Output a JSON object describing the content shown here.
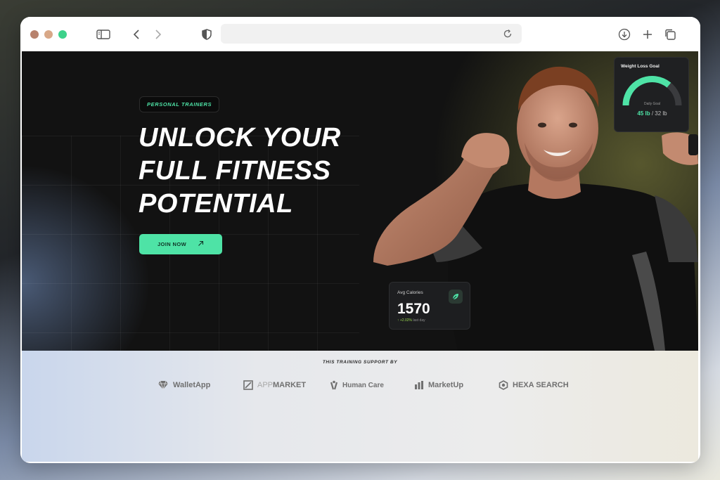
{
  "hero": {
    "badge": "PERSONAL TRAINERS",
    "headline": [
      "UNLOCK YOUR",
      "FULL FITNESS",
      "POTENTIAL"
    ],
    "cta_label": "JOIN NOW",
    "cta_icon": "arrow-up-right-icon"
  },
  "weight_card": {
    "title": "Weight Loss Goal",
    "gauge_label": "Daily Goal",
    "current": "45 lb",
    "separator": "/",
    "target": "32 lb",
    "progress": 0.72
  },
  "calories_card": {
    "label": "Avg Calories",
    "value": "1570",
    "delta": "+2.02%",
    "delta_suffix": "last day",
    "icon": "leaf-icon"
  },
  "sponsors": {
    "caption": "THIS TRAINING SUPPORT BY",
    "logos": [
      {
        "name": "WalletApp"
      },
      {
        "prefix": "APP",
        "name": "MARKET"
      },
      {
        "name": "Human Care"
      },
      {
        "name": "MarketUp"
      },
      {
        "name": "HEXA SEARCH"
      }
    ]
  },
  "colors": {
    "accent": "#4ee3a6",
    "hero_bg": "#121212"
  }
}
